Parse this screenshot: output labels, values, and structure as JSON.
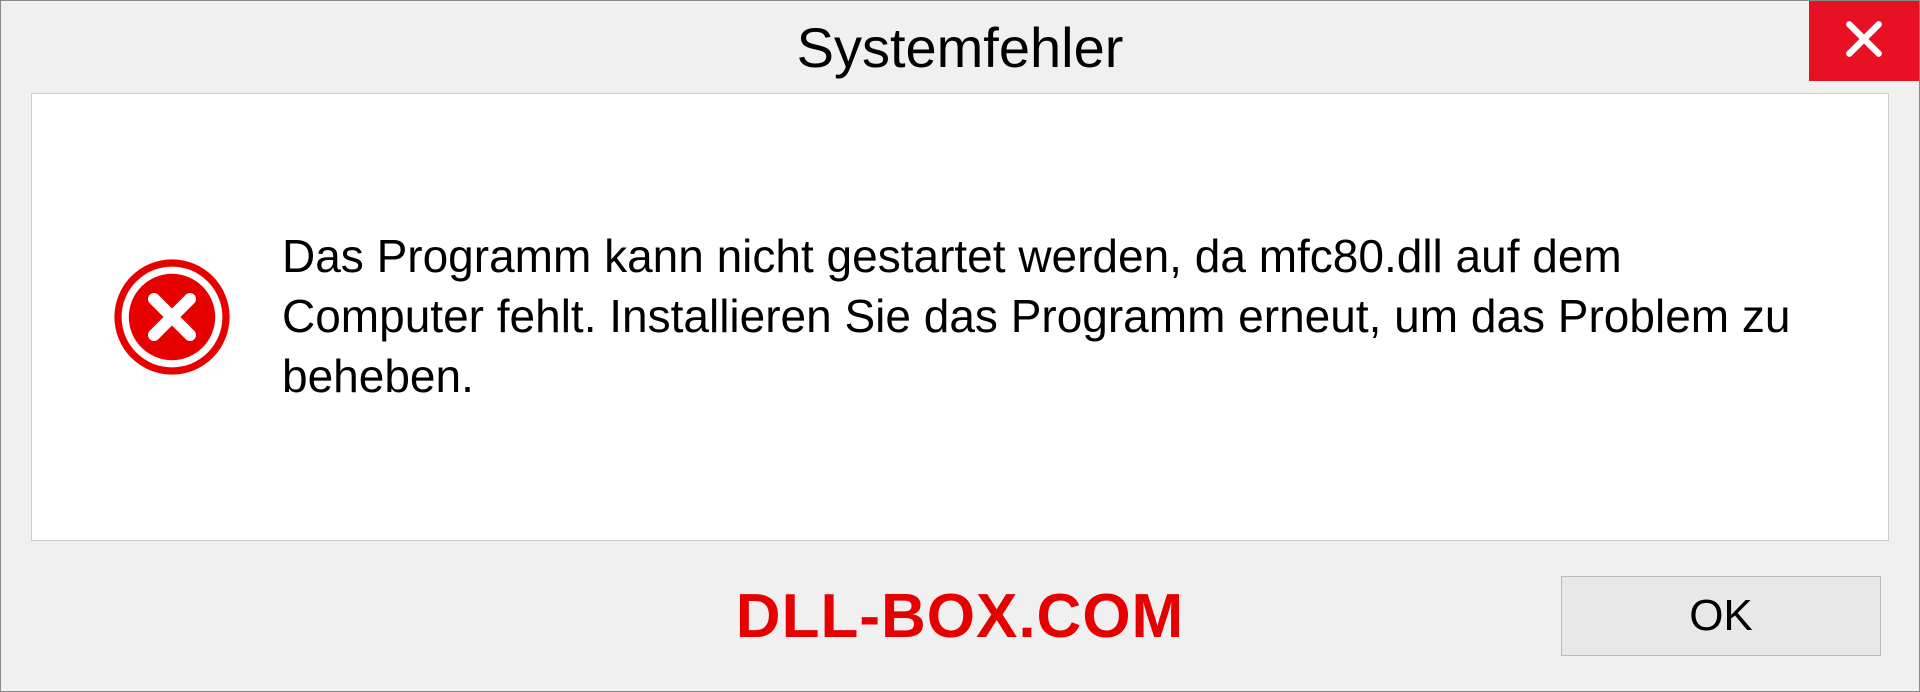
{
  "dialog": {
    "title": "Systemfehler",
    "message": "Das Programm kann nicht gestartet werden, da mfc80.dll auf dem Computer fehlt. Installieren Sie das Programm erneut, um das Problem zu beheben.",
    "ok_label": "OK",
    "watermark": "DLL-BOX.COM"
  }
}
